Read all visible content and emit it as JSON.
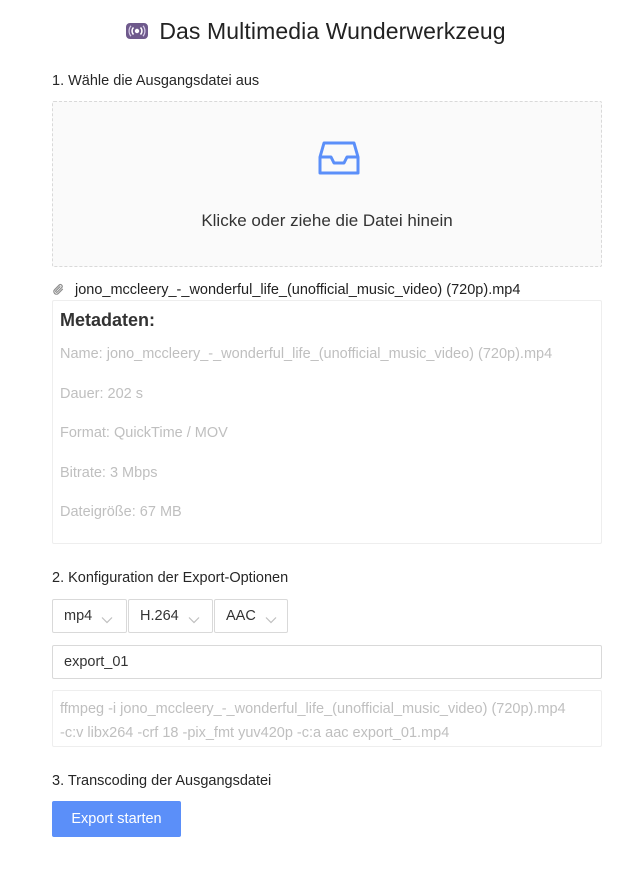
{
  "header": {
    "icon": "radio-broadcast-icon",
    "title": "Das Multimedia Wunderwerkzeug"
  },
  "step1": {
    "label": "1. Wähle die Ausgangsdatei aus",
    "dropzone": {
      "icon": "inbox-icon",
      "text": "Klicke oder ziehe die Datei hinein"
    },
    "file": {
      "icon": "paperclip-icon",
      "name": "jono_mccleery_-_wonderful_life_(unofficial_music_video) (720p).mp4"
    }
  },
  "metadata": {
    "title": "Metadaten:",
    "lines": [
      "Name: jono_mccleery_-_wonderful_life_(unofficial_music_video) (720p).mp4",
      "Dauer: 202 s",
      "Format: QuickTime / MOV",
      "Bitrate: 3 Mbps",
      "Dateigröße: 67 MB"
    ]
  },
  "step2": {
    "label": "2. Konfiguration der Export-Optionen",
    "selects": [
      {
        "value": "mp4"
      },
      {
        "value": "H.264"
      },
      {
        "value": "AAC"
      }
    ],
    "filename_value": "export_01",
    "command_lines": [
      "ffmpeg -i jono_mccleery_-_wonderful_life_(unofficial_music_video) (720p).mp4",
      "-c:v libx264 -crf 18 -pix_fmt yuv420p -c:a aac export_01.mp4"
    ]
  },
  "step3": {
    "label": "3. Transcoding der Ausgangsdatei",
    "button_label": "Export starten"
  },
  "colors": {
    "primary": "#5b8ff9",
    "icon_purple": "#6f5a8c",
    "muted_text": "#bfbfbf",
    "border": "#d9d9d9"
  }
}
